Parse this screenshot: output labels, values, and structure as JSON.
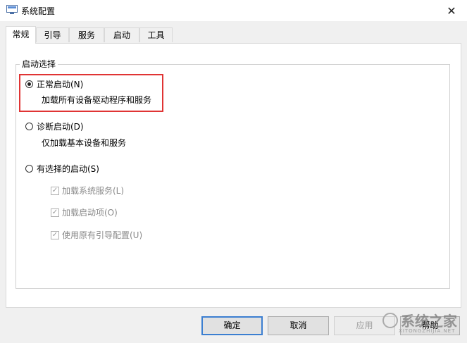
{
  "window": {
    "title": "系统配置",
    "close_glyph": "✕"
  },
  "tabs": [
    {
      "label": "常规",
      "active": true
    },
    {
      "label": "引导",
      "active": false
    },
    {
      "label": "服务",
      "active": false
    },
    {
      "label": "启动",
      "active": false
    },
    {
      "label": "工具",
      "active": false
    }
  ],
  "startup_group": {
    "legend": "启动选择",
    "normal": {
      "label": "正常启动(N)",
      "desc": "加载所有设备驱动程序和服务",
      "selected": true
    },
    "diagnostic": {
      "label": "诊断启动(D)",
      "desc": "仅加载基本设备和服务",
      "selected": false
    },
    "selective": {
      "label": "有选择的启动(S)",
      "selected": false
    },
    "options": [
      {
        "label": "加载系统服务(L)",
        "checked": true,
        "enabled": false
      },
      {
        "label": "加载启动项(O)",
        "checked": true,
        "enabled": false
      },
      {
        "label": "使用原有引导配置(U)",
        "checked": true,
        "enabled": false
      }
    ]
  },
  "buttons": {
    "ok": "确定",
    "cancel": "取消",
    "apply": "应用",
    "help": "帮助"
  },
  "watermark": {
    "text": "系统之家",
    "sub": "XITONGZHIJIA.NET"
  },
  "colors": {
    "highlight": "#e03434",
    "default_button_border": "#3c7fd1"
  }
}
